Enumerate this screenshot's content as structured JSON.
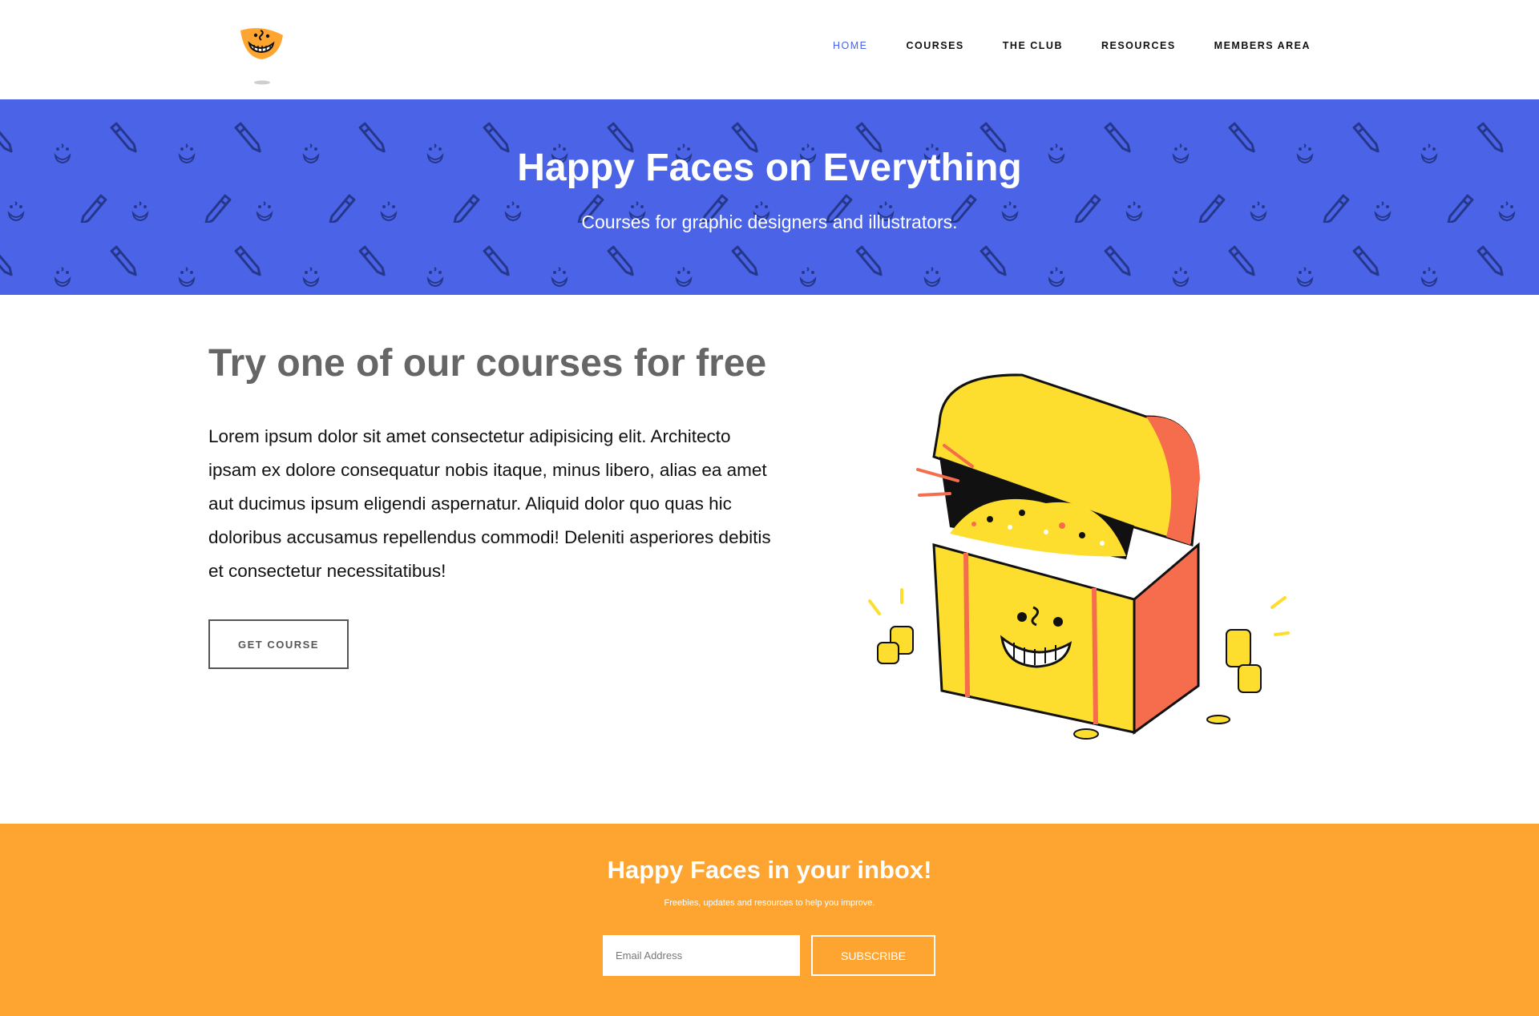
{
  "header": {
    "logo_icon": "happy-face-logo-icon",
    "nav": [
      {
        "label": "HOME",
        "active": true
      },
      {
        "label": "COURSES",
        "active": false
      },
      {
        "label": "THE CLUB",
        "active": false
      },
      {
        "label": "RESOURCES",
        "active": false
      },
      {
        "label": "MEMBERS AREA",
        "active": false
      }
    ]
  },
  "hero": {
    "title": "Happy Faces on Everything",
    "subtitle": "Courses for graphic designers and illustrators.",
    "background_color": "#4a63e7",
    "pattern_icons": [
      "pencil-icon",
      "smiley-face-icon"
    ]
  },
  "course": {
    "title": "Try one of our courses for free",
    "text": "Lorem ipsum dolor sit amet consectetur adipisicing elit. Architecto ipsam ex dolore consequatur nobis itaque, minus libero, alias ea amet aut ducimus ipsum eligendi aspernatur. Aliquid dolor quo quas hic doloribus accusamus repellendus commodi! Deleniti asperiores debitis et consectetur necessitatibus!",
    "button_label": "GET COURSE",
    "illustration": "treasure-chest-illustration"
  },
  "newsletter": {
    "title": "Happy Faces in your inbox!",
    "subtitle": "Freebies, updates and resources to help you improve.",
    "email_placeholder": "Email Address",
    "button_label": "SUBSCRIBE",
    "background_color": "#fea531"
  }
}
